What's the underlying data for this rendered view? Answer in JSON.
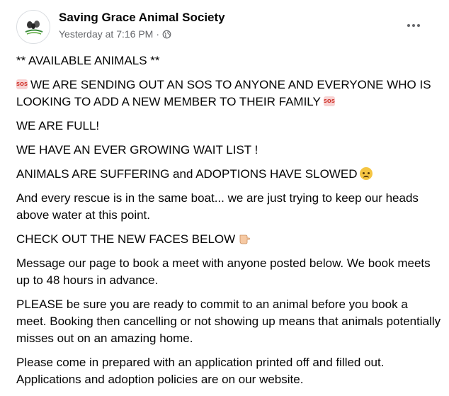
{
  "post": {
    "author": "Saving Grace Animal Society",
    "timestamp": "Yesterday at 7:16 PM",
    "separator": "·",
    "audience_icon": "globe-icon",
    "more_icon": "more-options-icon"
  },
  "content": {
    "p1": "** AVAILABLE ANIMALS **",
    "p2": "WE ARE SENDING OUT AN SOS TO ANYONE AND EVERYONE WHO IS LOOKING TO ADD A NEW MEMBER TO THEIR FAMILY",
    "p3": "WE ARE FULL!",
    "p4": "WE HAVE AN EVER GROWING WAIT LIST !",
    "p5": "ANIMALS ARE SUFFERING and ADOPTIONS HAVE SLOWED",
    "p6": "And every rescue is in the same boat... we are just trying to keep our heads above water at this point.",
    "p7": "CHECK OUT THE NEW FACES BELOW",
    "p8": "Message our page to book a meet with anyone posted below. We book meets up to 48 hours in advance.",
    "p9": "PLEASE be sure you are ready to commit to an animal before you book a meet.  Booking then cancelling or not showing up means that animals potentially misses out on an amazing home.",
    "p10": "Please come in prepared with an application printed off and filled out. Applications and adoption policies are on our website."
  },
  "colors": {
    "text": "#050505",
    "secondary": "#65676b",
    "background": "#ffffff"
  }
}
